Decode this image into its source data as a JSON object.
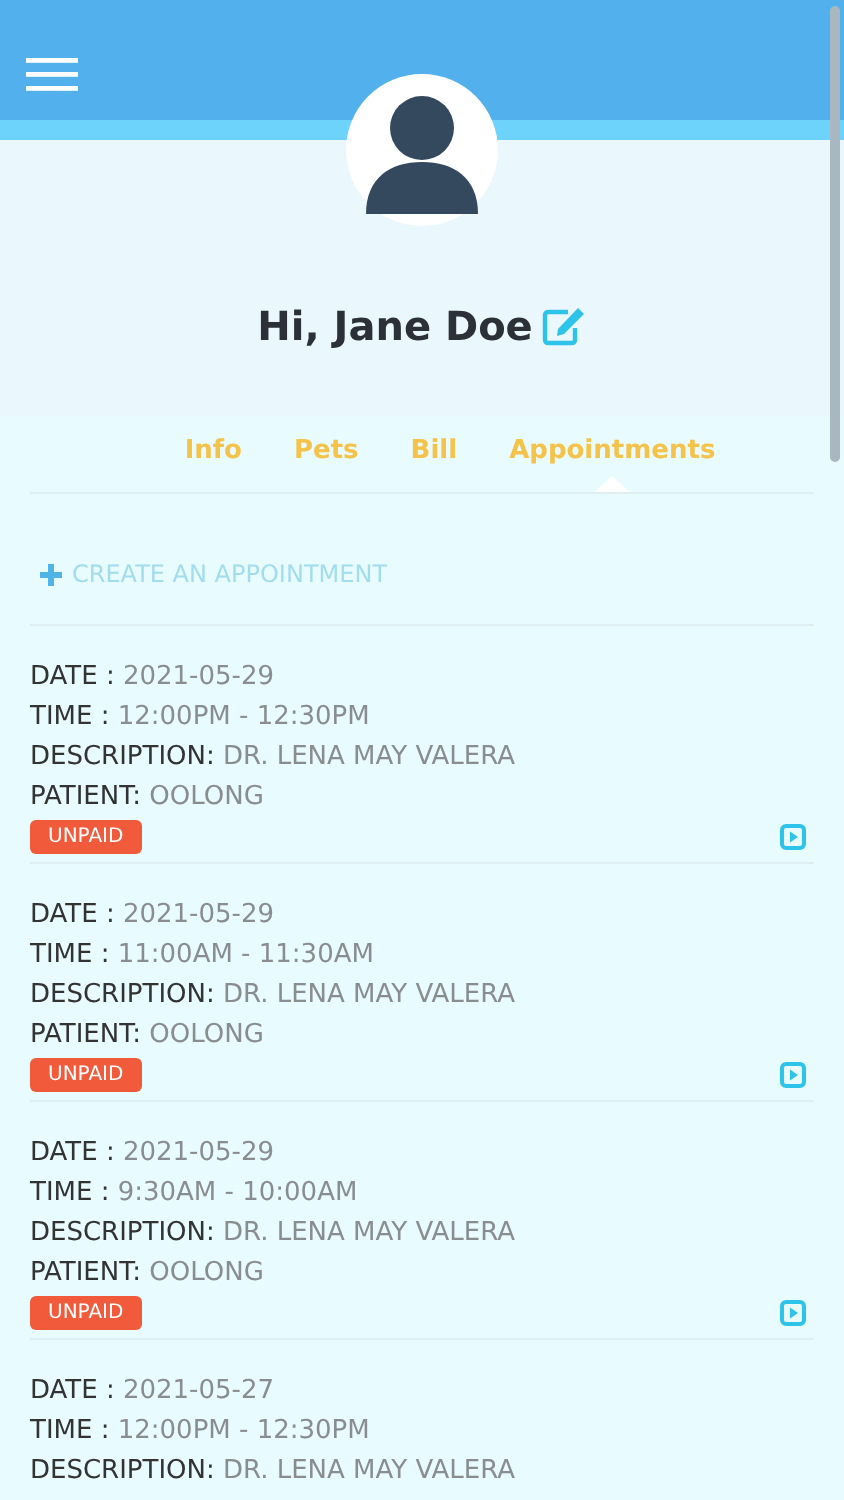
{
  "header": {
    "greeting": "Hi, Jane Doe"
  },
  "tabs": [
    {
      "label": "Info",
      "selected": false
    },
    {
      "label": "Pets",
      "selected": false
    },
    {
      "label": "Bill",
      "selected": false
    },
    {
      "label": "Appointments",
      "selected": true
    }
  ],
  "create_link": "CREATE AN APPOINTMENT",
  "appointments": [
    {
      "fields": [
        {
          "label": "DATE :",
          "value": "2021-05-29"
        },
        {
          "label": "TIME :",
          "value": "12:00PM - 12:30PM"
        },
        {
          "label": "DESCRIPTION:",
          "value": "DR. LENA MAY VALERA"
        },
        {
          "label": "PATIENT:",
          "value": "OOLONG"
        }
      ],
      "status": "UNPAID",
      "paid": false
    },
    {
      "fields": [
        {
          "label": "DATE :",
          "value": "2021-05-29"
        },
        {
          "label": "TIME :",
          "value": "11:00AM - 11:30AM"
        },
        {
          "label": "DESCRIPTION:",
          "value": "DR. LENA MAY VALERA"
        },
        {
          "label": "PATIENT:",
          "value": "OOLONG"
        }
      ],
      "status": "UNPAID",
      "paid": false
    },
    {
      "fields": [
        {
          "label": "DATE :",
          "value": "2021-05-29"
        },
        {
          "label": "TIME :",
          "value": "9:30AM - 10:00AM"
        },
        {
          "label": "DESCRIPTION:",
          "value": "DR. LENA MAY VALERA"
        },
        {
          "label": "PATIENT:",
          "value": "OOLONG"
        }
      ],
      "status": "UNPAID",
      "paid": false
    },
    {
      "fields": [
        {
          "label": "DATE :",
          "value": "2021-05-27"
        },
        {
          "label": "TIME :",
          "value": "12:00PM - 12:30PM"
        },
        {
          "label": "DESCRIPTION:",
          "value": "DR. LENA MAY VALERA"
        }
      ]
    }
  ]
}
